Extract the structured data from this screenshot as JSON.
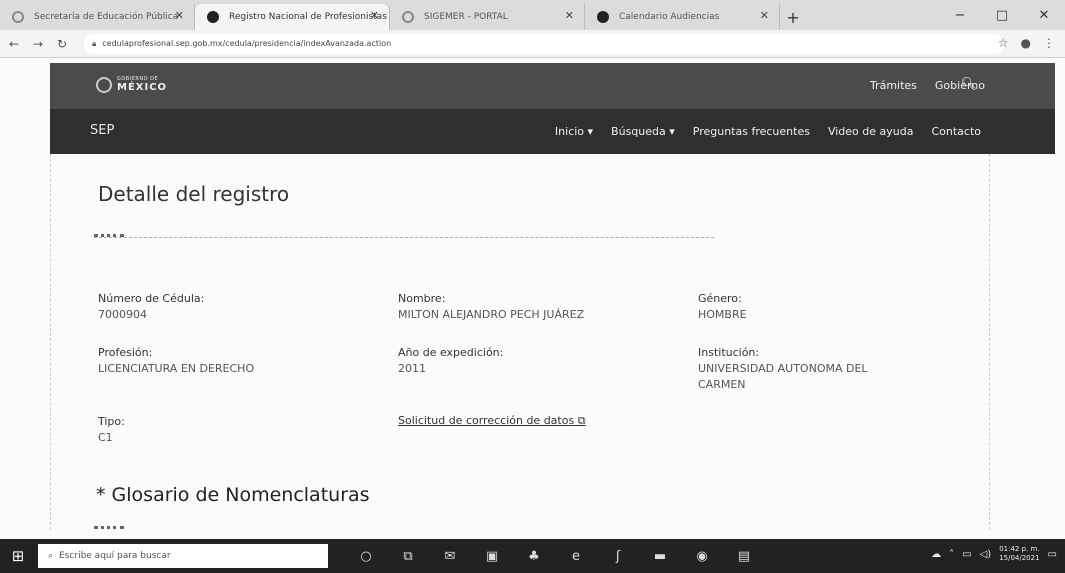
{
  "browser": {
    "tabs": [
      {
        "title": "Secretaría de Educación Pública",
        "fav": "sep-favicon",
        "active": false
      },
      {
        "title": "Registro Nacional de Profesionistas",
        "fav": "registro-favicon",
        "active": true
      },
      {
        "title": "SIGEMER - PORTAL",
        "fav": "generic-page-icon",
        "active": false
      },
      {
        "title": "Calendario Audiencias",
        "fav": "calendar-favicon",
        "active": false
      }
    ],
    "new_tab": "+",
    "url": "cedulaprofesional.sep.gob.mx/cedula/presidencia/indexAvanzada.action",
    "window_controls": [
      "−",
      "□",
      "✕"
    ]
  },
  "site": {
    "gob_small": "GOBIERNO DE",
    "gob_big": "MÉXICO",
    "gob_nav": [
      "Trámites",
      "Gobierno"
    ],
    "sep_label": "SEP",
    "sep_nav": [
      "Inicio ▾",
      "Búsqueda ▾",
      "Preguntas frecuentes",
      "Video de ayuda",
      "Contacto"
    ]
  },
  "detail": {
    "title": "Detalle del registro",
    "numero_label": "Número de Cédula:",
    "numero_value": "7000904",
    "nombre_label": "Nombre:",
    "nombre_value": "MILTON ALEJANDRO PECH JUÁREZ",
    "genero_label": "Género:",
    "genero_value": "HOMBRE",
    "profesion_label": "Profesión:",
    "profesion_value": "LICENCIATURA EN DERECHO",
    "anio_label": "Año de expedición:",
    "anio_value": "2011",
    "institucion_label": "Institución:",
    "institucion_value_1": "UNIVERSIDAD AUTONOMA DEL",
    "institucion_value_2": "CARMEN",
    "tipo_label": "Tipo:",
    "tipo_value": "C1",
    "correccion_link": "Solicitud de corrección de datos",
    "glosario_title": "* Glosario de Nomenclaturas"
  },
  "taskbar": {
    "search_placeholder": "Escribe aquí para buscar",
    "time": "01:42 p. m.",
    "date": "15/04/2021"
  }
}
